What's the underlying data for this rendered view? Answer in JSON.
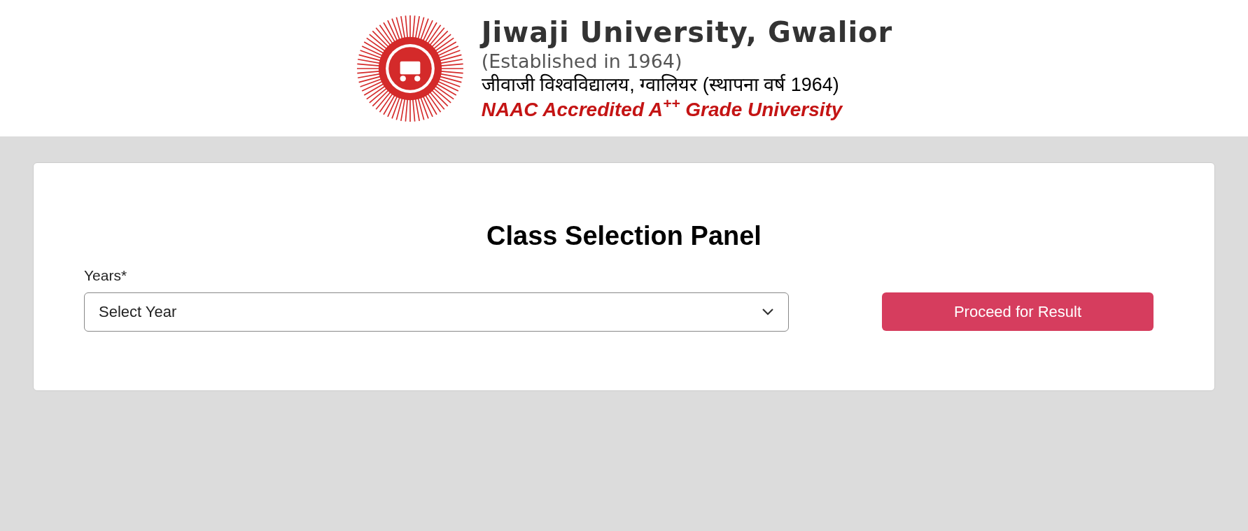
{
  "header": {
    "title": "Jiwaji University, Gwalior",
    "established": "(Established in 1964)",
    "hindi_title": "जीवाजी विश्वविद्यालय, ग्वालियर (स्थापना वर्ष 1964)",
    "accreditation": "NAAC Accredited A$^{++}$ Grade University"
  },
  "panel": {
    "title": "Class Selection Panel",
    "field": {
      "label": "Years*",
      "placeholder": "Select Year"
    },
    "button": "Proceed for Result"
  }
}
